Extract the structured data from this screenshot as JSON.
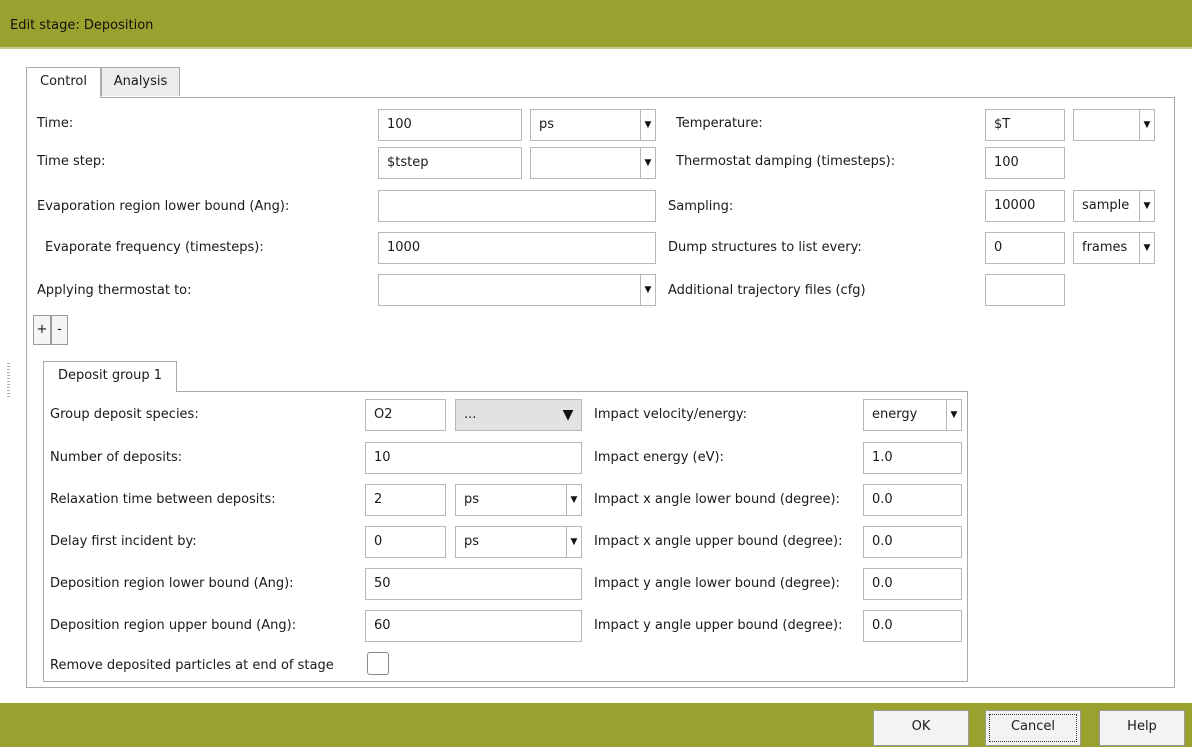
{
  "window": {
    "title": "Edit stage: Deposition"
  },
  "tabs": [
    {
      "label": "Control",
      "active": true
    },
    {
      "label": "Analysis",
      "active": false
    }
  ],
  "control": {
    "time": {
      "label": "Time:",
      "value": "100",
      "unit": "ps"
    },
    "time_step": {
      "label": "Time step:",
      "value": "$tstep",
      "unit": ""
    },
    "evap_lower": {
      "label": "Evaporation region lower bound (Ang):",
      "value": ""
    },
    "evap_freq": {
      "label": "Evaporate frequency (timesteps):",
      "value": "1000"
    },
    "thermostat_apply": {
      "label": "Applying thermostat to:",
      "value": ""
    },
    "temperature": {
      "label": "Temperature:",
      "value": "$T",
      "unit": ""
    },
    "thermostat_damping": {
      "label": "Thermostat damping (timesteps):",
      "value": "100"
    },
    "sampling": {
      "label": "Sampling:",
      "value": "10000",
      "unit": "sample"
    },
    "dump": {
      "label": "Dump structures to list every:",
      "value": "0",
      "unit": "frames"
    },
    "traj_files": {
      "label": "Additional trajectory files (cfg)",
      "value": ""
    },
    "add_label": "+",
    "remove_label": "-"
  },
  "deposit_group": {
    "tab_label": "Deposit group 1",
    "species": {
      "label": "Group deposit species:",
      "value": "O2",
      "option": "..."
    },
    "num_deposits": {
      "label": "Number of deposits:",
      "value": "10"
    },
    "relaxation": {
      "label": "Relaxation time between deposits:",
      "value": "2",
      "unit": "ps"
    },
    "delay": {
      "label": "Delay first incident by:",
      "value": "0",
      "unit": "ps"
    },
    "region_lower": {
      "label": "Deposition region lower bound (Ang):",
      "value": "50"
    },
    "region_upper": {
      "label": "Deposition region upper bound (Ang):",
      "value": "60"
    },
    "remove": {
      "label": "Remove deposited particles at end of stage",
      "checked": false
    },
    "impact_mode": {
      "label": "Impact velocity/energy:",
      "value": "energy"
    },
    "impact_energy": {
      "label": "Impact energy (eV):",
      "value": "1.0"
    },
    "x_angle_lower": {
      "label": "Impact x angle lower bound (degree):",
      "value": "0.0"
    },
    "x_angle_upper": {
      "label": "Impact x angle upper bound (degree):",
      "value": "0.0"
    },
    "y_angle_lower": {
      "label": "Impact y angle lower bound (degree):",
      "value": "0.0"
    },
    "y_angle_upper": {
      "label": "Impact y angle upper bound (degree):",
      "value": "0.0"
    }
  },
  "buttons": {
    "ok": "OK",
    "cancel": "Cancel",
    "help": "Help"
  },
  "colors": {
    "title_bar": "#9aa22f",
    "panel_border": "#a9a9a9"
  }
}
